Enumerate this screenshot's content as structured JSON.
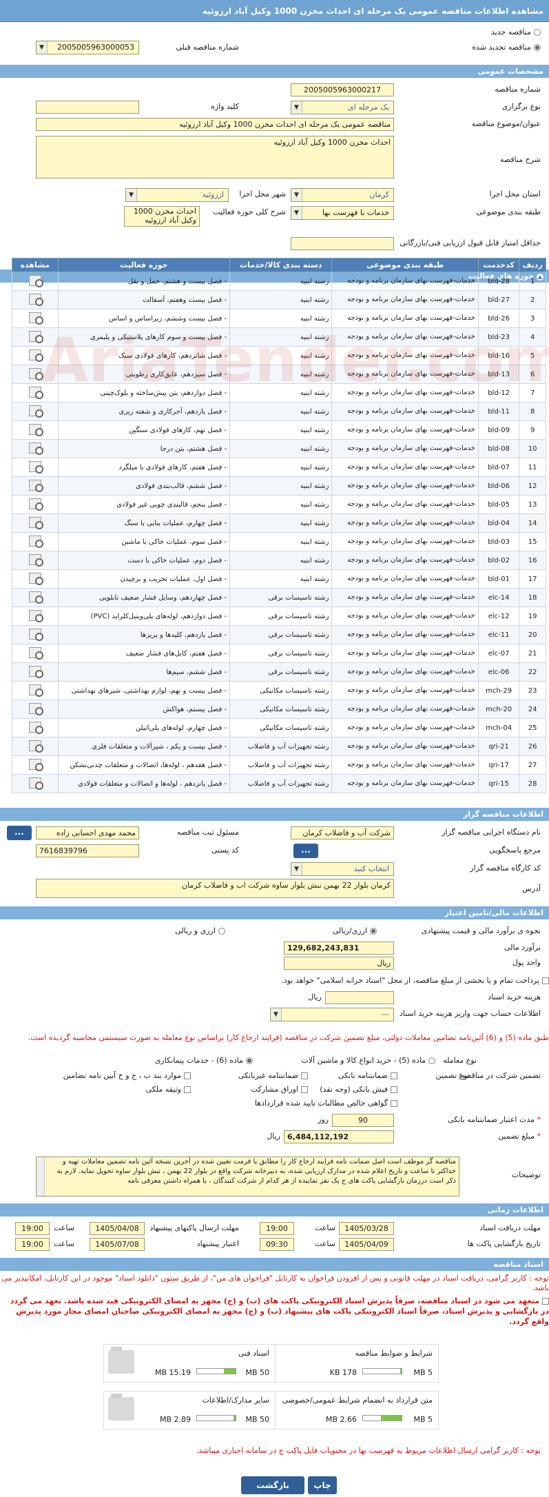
{
  "title": "مشاهده اطلاعات مناقصه عمومی یک مرحله ای احداث مخزن 1000 وکیل آباد ارزوئیه",
  "top": {
    "radio_new": "مناقصه جدید",
    "radio_renew": "مناقصه تجدید شده",
    "prev_label": "شماره مناقصه قبلی",
    "prev_value": "2005005963000053"
  },
  "general": {
    "section": "مشخصات عمومی",
    "number_label": "شماره مناقصه",
    "number_value": "2005005963000217",
    "type_label": "نوع برگزاری",
    "type_value": "یک مرحله ای",
    "keyword_label": "کلید واژه",
    "subject_label": "عنوان/موضوع مناقصه",
    "subject_value": "مناقصه عمومی یک مرحله ای احداث مخزن 1000 وکیل آباد ارزوئیه",
    "desc_label": "شرح مناقصه",
    "desc_value": "احداث مخزن 1000 وکیل آباد ارزوئیه",
    "province_label": "استان محل اجرا",
    "province_value": "کرمان",
    "city_label": "شهر محل اجرا",
    "city_value": "ارزوئیه",
    "category_label": "طبقه بندی موضوعی",
    "category_value": "خدمات با فهرست بها",
    "scope_label": "شرح کلی حوزه فعالیت",
    "scope_value": "احداث مخزن 1000 وکیل آباد ارزوئیه",
    "min_score_label": "حداقل امتیاز قابل قبول ارزیابی فنی/بازرگانی"
  },
  "grid": {
    "section": "حوزه های فعالیت",
    "headers": [
      "ردیف",
      "کدخدمت",
      "طبقه بندی موضوعی",
      "دسته بندی کالا/خدمات",
      "حوزه فعالیت",
      "مشاهده"
    ],
    "rows": [
      [
        "1",
        "bld-28",
        "خدمات-فهرست بهای سازمان برنامه و بودجه",
        "رشته ابنیه",
        "- فصل بیست و هشتم، حمل و نقل"
      ],
      [
        "2",
        "bld-27",
        "خدمات-فهرست بهای سازمان برنامه و بودجه",
        "رشته ابنیه",
        "- فصل بیست وهفتم، آسفالت"
      ],
      [
        "3",
        "bld-26",
        "خدمات-فهرست بهای سازمان برنامه و بودجه",
        "رشته ابنیه",
        "- فصل بیست وششم، زیراساس و اساس"
      ],
      [
        "4",
        "bld-23",
        "خدمات-فهرست بهای سازمان برنامه و بودجه",
        "رشته ابنیه",
        "- فصل بیست و سوم کارهای پلاستیکی و پلیمری"
      ],
      [
        "5",
        "bld-16",
        "خدمات-فهرست بهای سازمان برنامه و بودجه",
        "رشته ابنیه",
        "- فصل شانزدهم، کارهای فولادی سبک"
      ],
      [
        "6",
        "bld-13",
        "خدمات-فهرست بهای سازمان برنامه و بودجه",
        "رشته ابنیه",
        "- فصل سیزدهم، عایق‌کاری رطوبتی"
      ],
      [
        "7",
        "bld-12",
        "خدمات-فهرست بهای سازمان برنامه و بودجه",
        "رشته ابنیه",
        "- فصل دوازدهم، بتن پیش‌ساخته و بلوک‌چینی"
      ],
      [
        "8",
        "bld-11",
        "خدمات-فهرست بهای سازمان برنامه و بودجه",
        "رشته ابنیه",
        "- فصل یازدهم، آجرکاری و شفته ریزی"
      ],
      [
        "9",
        "bld-09",
        "خدمات-فهرست بهای سازمان برنامه و بودجه",
        "رشته ابنیه",
        "- فصل نهم، کارهای فولادی سنگین"
      ],
      [
        "10",
        "bld-08",
        "خدمات-فهرست بهای سازمان برنامه و بودجه",
        "رشته ابنیه",
        "- فصل هشتم، بتن درجا"
      ],
      [
        "11",
        "bld-07",
        "خدمات-فهرست بهای سازمان برنامه و بودجه",
        "رشته ابنیه",
        "- فصل هفتم، کارهای فولادی با میلگرد"
      ],
      [
        "12",
        "bld-06",
        "خدمات-فهرست بهای سازمان برنامه و بودجه",
        "رشته ابنیه",
        "- فصل ششم، قالب‌بندی فولادی"
      ],
      [
        "13",
        "bld-05",
        "خدمات-فهرست بهای سازمان برنامه و بودجه",
        "رشته ابنیه",
        "- فصل پنجم، قالبندی چوبی غیر فولادی"
      ],
      [
        "14",
        "bld-04",
        "خدمات-فهرست بهای سازمان برنامه و بودجه",
        "رشته ابنیه",
        "- فصل چهارم، عملیات بنایی با سنگ"
      ],
      [
        "15",
        "bld-03",
        "خدمات-فهرست بهای سازمان برنامه و بودجه",
        "رشته ابنیه",
        "- فصل سوم، عملیات خاکی با ماشین"
      ],
      [
        "16",
        "bld-02",
        "خدمات-فهرست بهای سازمان برنامه و بودجه",
        "رشته ابنیه",
        "- فصل دوم، عملیات خاکی با دست"
      ],
      [
        "17",
        "bld-01",
        "خدمات-فهرست بهای سازمان برنامه و بودجه",
        "رشته ابنیه",
        "- فصل اول، عملیات تخریب و برچیدن"
      ],
      [
        "18",
        "elc-14",
        "خدمات-فهرست بهای سازمان برنامه و بودجه",
        "رشته تاسیسات برقی",
        "- فصل چهاردهم، وسایل فشار ضعیف تابلویی"
      ],
      [
        "19",
        "elc-12",
        "خدمات-فهرست بهای سازمان برنامه و بودجه",
        "رشته تاسیسات برقی",
        "- فصل دوازدهم، لوله‌های پلی‌وینیل‌کلراید (PVC)"
      ],
      [
        "20",
        "elc-11",
        "خدمات-فهرست بهای سازمان برنامه و بودجه",
        "رشته تاسیسات برقی",
        "- فصل یازدهم، کلیدها و پریزها"
      ],
      [
        "21",
        "elc-07",
        "خدمات-فهرست بهای سازمان برنامه و بودجه",
        "رشته تاسیسات برقی",
        "- فصل هفتم، کابل‌های فشار ضعیف"
      ],
      [
        "22",
        "elc-06",
        "خدمات-فهرست بهای سازمان برنامه و بودجه",
        "رشته تاسیسات برقی",
        "- فصل ششم، سیم‌ها"
      ],
      [
        "23",
        "mch-29",
        "خدمات-فهرست بهای سازمان برنامه و بودجه",
        "رشته تاسیسات مکانیکی",
        "- فصل بیست و نهم، لوازم بهداشتی، شیرهای بهداشتی"
      ],
      [
        "24",
        "mch-20",
        "خدمات-فهرست بهای سازمان برنامه و بودجه",
        "رشته تاسیسات مکانیکی",
        "- فصل بیستم، هواکش"
      ],
      [
        "25",
        "mch-04",
        "خدمات-فهرست بهای سازمان برنامه و بودجه",
        "رشته تاسیسات مکانیکی",
        "- فصل چهارم، لوله‌های پلی‌اتیلن"
      ],
      [
        "26",
        "qri-21",
        "خدمات-فهرست بهای سازمان برنامه و بودجه",
        "رشته تجهیزات آب و فاضلاب",
        "- فصل بیست و یکم ، شیرآلات و متعلقات فلزی"
      ],
      [
        "27",
        "qri-17",
        "خدمات-فهرست بهای سازمان برنامه و بودجه",
        "رشته تجهیزات آب و فاضلاب",
        "- فصل هفدهم ، لوله‌ها، اتصالات و متعلقات چدنی‌نشکن"
      ],
      [
        "28",
        "qri-15",
        "خدمات-فهرست بهای سازمان برنامه و بودجه",
        "رشته تجهیزات آب و فاضلاب",
        "- فصل پانزدهم ، لوله‌ها و اتصالات و متعلقات فولادی"
      ]
    ]
  },
  "org": {
    "section": "اطلاعات مناقصه گزار",
    "name_label": "نام دستگاه اجرایی مناقصه گزار",
    "name_value": "شرکت آب و فاضلاب کرمان",
    "resp_label": "مسئول ثبت مناقصه",
    "resp_value": "محمد مهدی احسانی زاده",
    "ref_label": "مرجع پاسخگویی",
    "postal_label": "کد پستی",
    "postal_value": "7616839796",
    "unit_label": "کد کارگاه مناقصه گزار",
    "unit_value": "انتخاب کنید",
    "addr_label": "آدرس",
    "addr_value": "کرمان بلوار 22 بهمن نبش بلوار ساوه شرکت اب و فاضلاب کرمان",
    "dots": "..."
  },
  "finance": {
    "section": "اطلاعات مالی/تامین اعتبار",
    "est_label": "نحوه ی برآورد مالی و قیمت پیشنهادی",
    "opt1": "ارزی/ریالی",
    "opt2": "ارزی و ریالی",
    "budget_label": "برآورد مالی",
    "budget_value": "129,682,243,831",
    "unit_label": "واحد پول",
    "unit_value": "ریال",
    "pay_text": "پرداخت تمام و یا بخشی از مبلغ مناقصه، از محل \"اسناد خزانه اسلامی\" خواهد بود.",
    "doc_cost_label": "هزینه خرید اسناد",
    "doc_cost_unit": "ریال",
    "acct_label": "اطلاعات حساب جهت واریز هزینه خرید اسناد",
    "acct_value": "---",
    "warn": "طبق ماده (5) و (6) آئین‌نامه تضامین معاملات دولتی، مبلغ تضمین شرکت در مناقصه (فرایند ارجاع کار) براساس نوع معامله به صورت سیستمی محاسبه گردیده است.",
    "deal_label": "نوع معامله",
    "deal_a": "ماده (5) - خرید انواع کالا و ماشین آلات",
    "deal_b": "ماده (6) - خدمات پیمانکاری",
    "guar_label": "تضمین شرکت در مناقصه:",
    "guar_type": "نوع تضمین",
    "g1": "ضمانتنامه بانکی",
    "g2": "ضمانتنامه غیربانکی",
    "g3": "موارد بند ب ، ج و خ آیین نامه تضامین",
    "g4": "فیش بانکی (وجه نقد)",
    "g5": "اوراق مشارکت",
    "g6": "وثیقه ملکی",
    "g7": "گواهی خالص مطالبات تایید شده قراردادها",
    "valid_label": "مدت اعتبار ضمانتنامه بانکی",
    "valid_value": "90",
    "valid_unit": "روز",
    "amount_label": "مبلغ تضمین",
    "amount_value": "6,484,112,192",
    "amount_unit": "ریال",
    "notes_label": "توضیحات",
    "notes_value": "مناقصه گر موظف است اصل ضمانت نامه فرایند ارجاع کار را مطابق با فرمت تعیین شده در آخرین نسخه آئین نامه تضمین معاملات  تهیه و حداکثر تا ساعت و تاریخ اعلام شده در مدارک ارزیابی شده، به  دبیرخانه شرکت واقع در بلوار 22 بهمن ، نبش بلوار ساوه تحویل نماید. لازم به ذکر است  درزمان بازگشایی پاکت های  ج  یک نفر نماینده از هر کدام از شرکت کنندگان ، با همراه داشتن معرفی نامه"
  },
  "time": {
    "section": "اطلاعات زمانی",
    "r1l": "مهلت دریافت اسناد",
    "r1d": "1405/03/28",
    "r1t": "19:00",
    "r1l2": "مهلت ارسال پاکتهای پیشنهاد",
    "r1d2": "1405/04/08",
    "r1t2": "19:00",
    "r2l": "تاریخ بازگشایی پاکت ها",
    "r2d": "1405/04/09",
    "r2t": "09:30",
    "r2l2": "اعتبار پیشنهاد",
    "r2d2": "1405/07/08",
    "r2t2": "19:00",
    "time_label": "ساعت"
  },
  "docs": {
    "section": "اسناد مناقصه",
    "note1": "توجه : کاربر گرامی، دریافت اسناد در مهلت قانونی و پس از افزودن فراخوان به کارتابل \"فراخوان های من\"، از طریق ستون \"دانلود اسناد\" موجود در این کارتابل، امکانپذیر می باشد.",
    "note2": "متعهد می شود در اسناد مناقصه، صرفاً پذیرش اسناد الکترونیکی پاکت های (ب) و (ج) مجهز به امضای الکترونیکی قید شده باشد. تعهد می گردد در بازگشایی و پذیرش اسناد، صرفاً اسناد الکترونیکی پاکت های پیشنهاد (ب) و (ج) مجهز به امضای الکترونیکی صاحبان امضای مجاز مورد پذیرش واقع گردد.",
    "files": [
      {
        "name": "شرایط و ضوابط مناقصه",
        "max": "5 MB",
        "size": "178 KB",
        "pct": 4
      },
      {
        "name": "اسناد فنی",
        "max": "50 MB",
        "size": "15.19 MB",
        "pct": 30
      },
      {
        "name": "متن قرارداد به انضمام شرایط عمومی/خصوصی",
        "max": "5 MB",
        "size": "2.66 MB",
        "pct": 53
      },
      {
        "name": "سایر مدارک/اطلاعات",
        "max": "50 MB",
        "size": "2.89 MB",
        "pct": 6
      }
    ],
    "note3": "توجه : کاربر گرامی ارسال اطلاعات مربوط به فهرست بها در محتویات فایل پاکت ج در سامانه اجباری میباشد."
  },
  "buttons": {
    "print": "چاپ",
    "back": "بازگشت"
  },
  "watermark": "AriaTender.com"
}
